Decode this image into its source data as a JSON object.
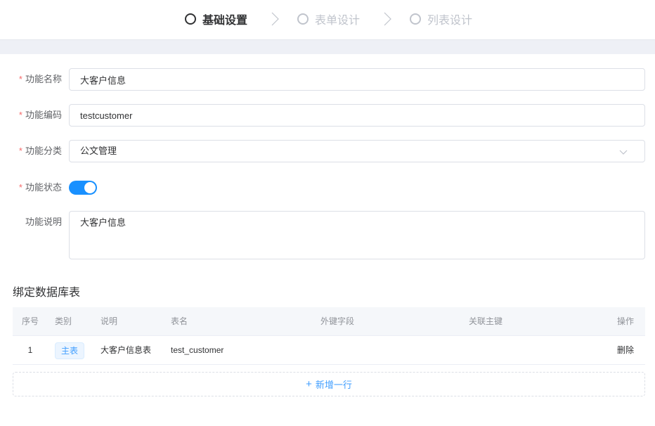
{
  "steps": [
    {
      "label": "基础设置",
      "active": true
    },
    {
      "label": "表单设计",
      "active": false
    },
    {
      "label": "列表设计",
      "active": false
    }
  ],
  "form": {
    "name": {
      "label": "功能名称",
      "value": "大客户信息",
      "required": true
    },
    "code": {
      "label": "功能编码",
      "value": "testcustomer",
      "required": true
    },
    "category": {
      "label": "功能分类",
      "value": "公文管理",
      "required": true
    },
    "status": {
      "label": "功能状态",
      "enabled": true,
      "required": true
    },
    "description": {
      "label": "功能说明",
      "value": "大客户信息",
      "required": false
    }
  },
  "binding": {
    "title": "绑定数据库表",
    "columns": {
      "index": "序号",
      "type": "类别",
      "desc": "说明",
      "table_name": "表名",
      "foreign_key": "外键字段",
      "primary_key": "关联主键",
      "action": "操作"
    },
    "rows": [
      {
        "index": "1",
        "type": "主表",
        "desc": "大客户信息表",
        "table_name": "test_customer",
        "foreign_key": "",
        "primary_key": "",
        "action": "删除"
      }
    ],
    "add_row_label": "新增一行"
  },
  "colors": {
    "accent": "#1890ff",
    "link": "#409eff",
    "danger": "#f56c6c"
  }
}
